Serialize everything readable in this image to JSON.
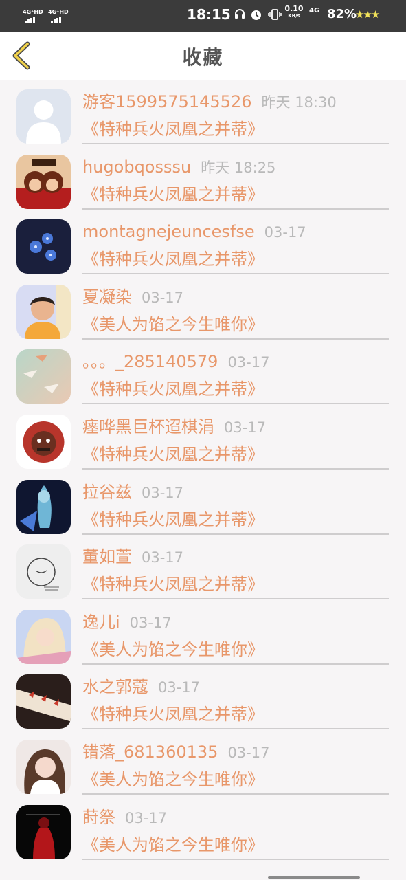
{
  "status_bar": {
    "sim1": "4G⁺HD",
    "sim2": "4G⁺HD",
    "time": "18:15",
    "speed_value": "0.10",
    "speed_unit": "KB/s",
    "network": "4G",
    "battery": "82%",
    "stars": "★★★"
  },
  "header": {
    "title": "收藏"
  },
  "favorites": [
    {
      "user": "游客1599575145526",
      "time": "昨天 18:30",
      "book": "《特种兵火凤凰之并蒂》"
    },
    {
      "user": "hugobqosssu",
      "time": "昨天 18:25",
      "book": "《特种兵火凤凰之并蒂》"
    },
    {
      "user": "montagnejeuncesfse",
      "time": "03-17",
      "book": "《特种兵火凤凰之并蒂》"
    },
    {
      "user": "夏凝染",
      "time": "03-17",
      "book": "《美人为馅之今生唯你》"
    },
    {
      "user": "。。。_285140579",
      "time": "03-17",
      "book": "《特种兵火凤凰之并蒂》"
    },
    {
      "user": "瘗哗黑巨杯迢棋涓",
      "time": "03-17",
      "book": "《特种兵火凤凰之并蒂》"
    },
    {
      "user": "拉谷兹",
      "time": "03-17",
      "book": "《特种兵火凤凰之并蒂》"
    },
    {
      "user": "董如萱",
      "time": "03-17",
      "book": "《特种兵火凤凰之并蒂》"
    },
    {
      "user": "逸儿i",
      "time": "03-17",
      "book": "《美人为馅之今生唯你》"
    },
    {
      "user": "水之郭蔻",
      "time": "03-17",
      "book": "《特种兵火凤凰之并蒂》"
    },
    {
      "user": "错落_681360135",
      "time": "03-17",
      "book": "《美人为馅之今生唯你》"
    },
    {
      "user": "莳祭",
      "time": "03-17",
      "book": "《美人为馅之今生唯你》"
    }
  ]
}
